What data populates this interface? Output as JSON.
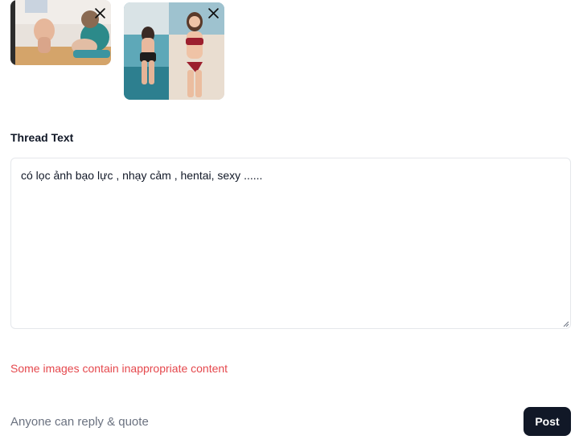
{
  "attachments": [
    {
      "name": "image-1",
      "remove_icon": "close-icon"
    },
    {
      "name": "image-2",
      "remove_icon": "close-icon"
    }
  ],
  "form": {
    "label": "Thread Text",
    "thread_text": "có lọc ảnh bạo lực , nhạy cảm , hentai, sexy ......",
    "error": "Some images contain inappropriate content"
  },
  "footer": {
    "reply_setting": "Anyone can reply & quote",
    "post_label": "Post"
  },
  "colors": {
    "error": "#e5484d",
    "button_bg": "#111827",
    "muted_text": "#6b7280"
  }
}
